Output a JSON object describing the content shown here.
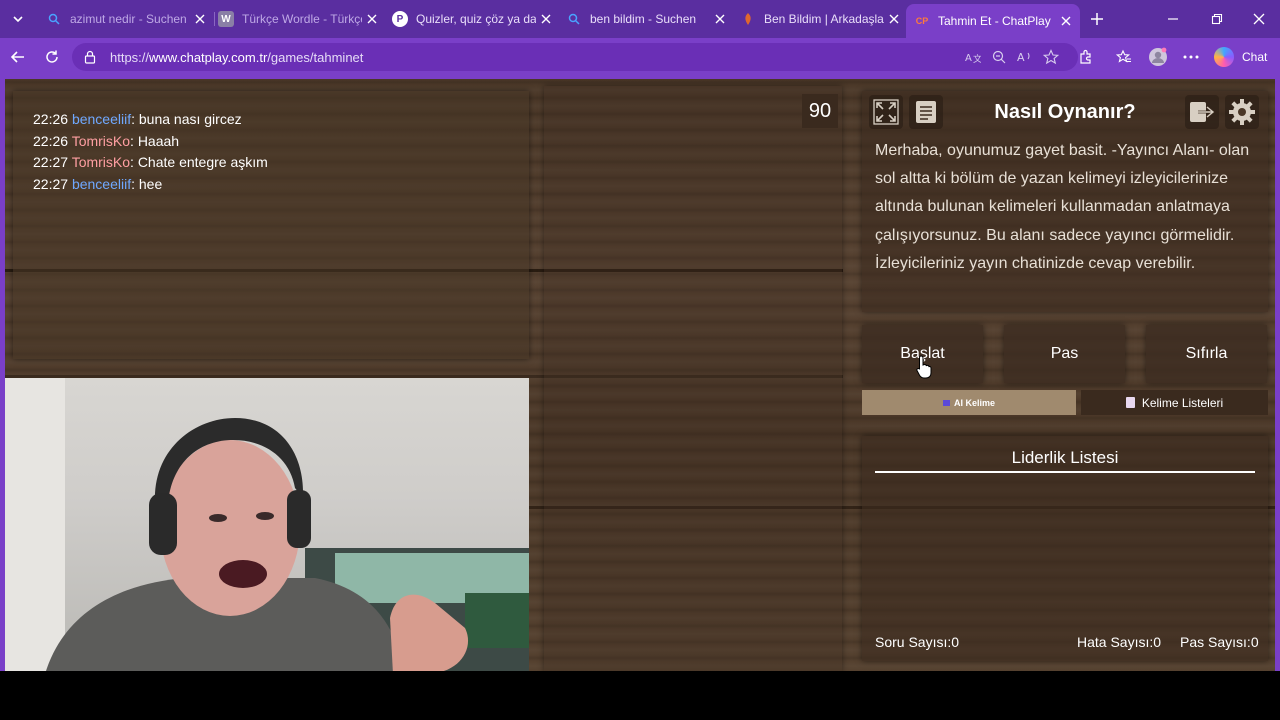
{
  "browser": {
    "tabs": [
      {
        "title": "azimut nedir - Suchen",
        "icon": "search-icon"
      },
      {
        "title": "Türkçe Wordle - Türkçe K",
        "icon": "wordle-icon"
      },
      {
        "title": "Quizler, quiz çöz ya da o",
        "icon": "quiz-icon"
      },
      {
        "title": "ben bildim - Suchen",
        "icon": "search-icon"
      },
      {
        "title": "Ben Bildim | Arkadaşları",
        "icon": "benbildim-icon"
      },
      {
        "title": "Tahmin Et - ChatPlay",
        "icon": "chatplay-icon",
        "favicon_text": "CP",
        "active": true
      }
    ],
    "url_prefix": "https://",
    "url_host": "www.chatplay.com.tr",
    "url_path": "/games/tahminet",
    "copilot_label": "Chat",
    "accent": "#7a3fc8"
  },
  "chat": {
    "messages": [
      {
        "time": "22:26",
        "user": "benceeliif",
        "text": ": buna nası gircez"
      },
      {
        "time": "22:26",
        "user": "TomrisKo",
        "text": ": Haaah"
      },
      {
        "time": "22:27",
        "user": "TomrisKo",
        "text": ": Chate entegre aşkım"
      },
      {
        "time": "22:27",
        "user": "benceeliif",
        "text": ": hee"
      }
    ]
  },
  "game": {
    "timer": "90",
    "how_title": "Nasıl Oynanır?",
    "how_text": "Merhaba, oyunumuz gayet basit. -Yayıncı Alanı- olan sol altta ki bölüm de yazan kelimeyi izleyicilerinize altında bulunan kelimeleri kullanmadan anlatmaya çalışıyorsunuz. Bu alanı sadece yayıncı görmelidir. İzleyicileriniz yayın chatinizde cevap verebilir.",
    "buttons": {
      "start": "Başlat",
      "pass": "Pas",
      "reset": "Sıfırla"
    },
    "ai_word": "AI Kelime",
    "word_lists": "Kelime Listeleri",
    "leaderboard_title": "Liderlik Listesi",
    "stats": {
      "questions_label": "Soru Sayısı:",
      "questions": "0",
      "errors_label": "Hata Sayısı:",
      "errors": "0",
      "passes_label": "Pas Sayısı:",
      "passes": "0"
    }
  }
}
